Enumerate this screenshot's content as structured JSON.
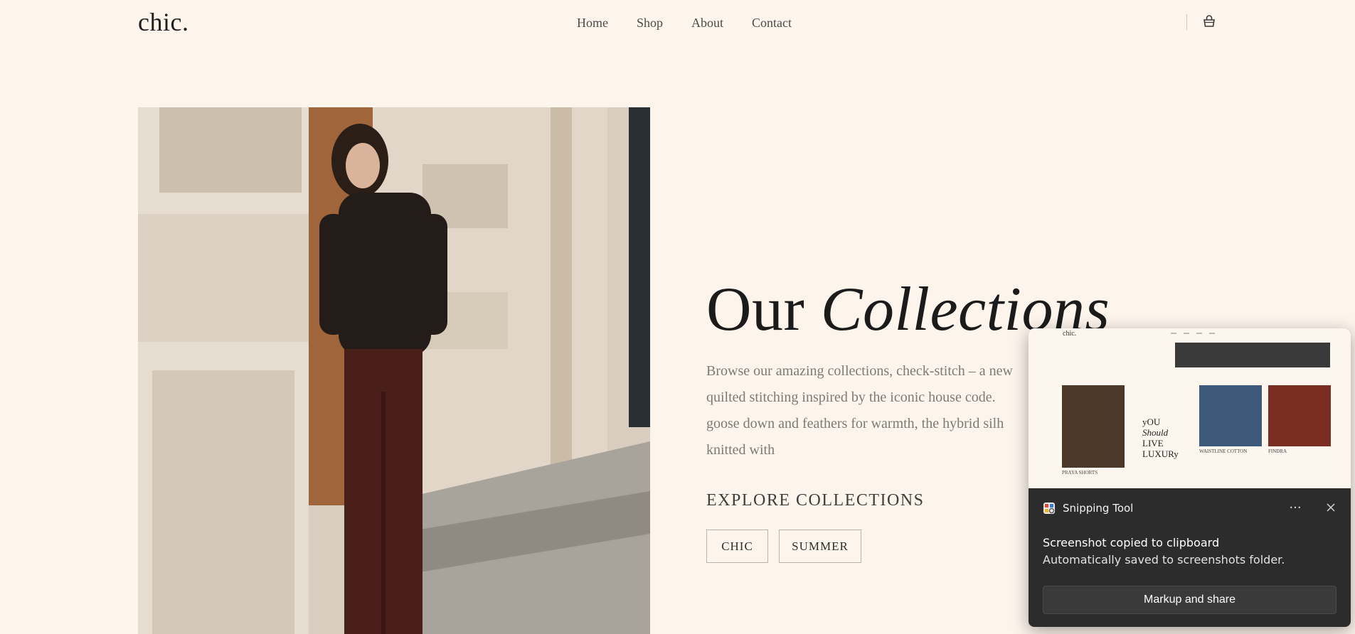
{
  "header": {
    "logo": "chic.",
    "nav": [
      "Home",
      "Shop",
      "About",
      "Contact"
    ],
    "cart_icon": "basket-icon"
  },
  "hero": {
    "heading_plain": "Our",
    "heading_italic": "Collections",
    "description": "Browse our amazing collections, check-stitch – a new quilted stitching inspired by the iconic house code. goose down and feathers for warmth, the hybrid silh knitted with",
    "explore_label": "EXPLORE COLLECTIONS",
    "buttons": [
      "CHIC",
      "SUMMER"
    ]
  },
  "toast": {
    "app_name": "Snipping Tool",
    "title": "Screenshot copied to clipboard",
    "subtitle": "Automatically saved to screenshots folder.",
    "action": "Markup and share",
    "more_icon": "more-icon",
    "close_icon": "close-icon",
    "thumbnail": {
      "logo": "chic.",
      "slogan": [
        "yOU",
        "Should",
        "LIVE",
        "LUXURy"
      ],
      "captions": [
        "PRAYA SHORTS",
        "WAISTLINE COTTON",
        "FINDRA"
      ]
    }
  }
}
